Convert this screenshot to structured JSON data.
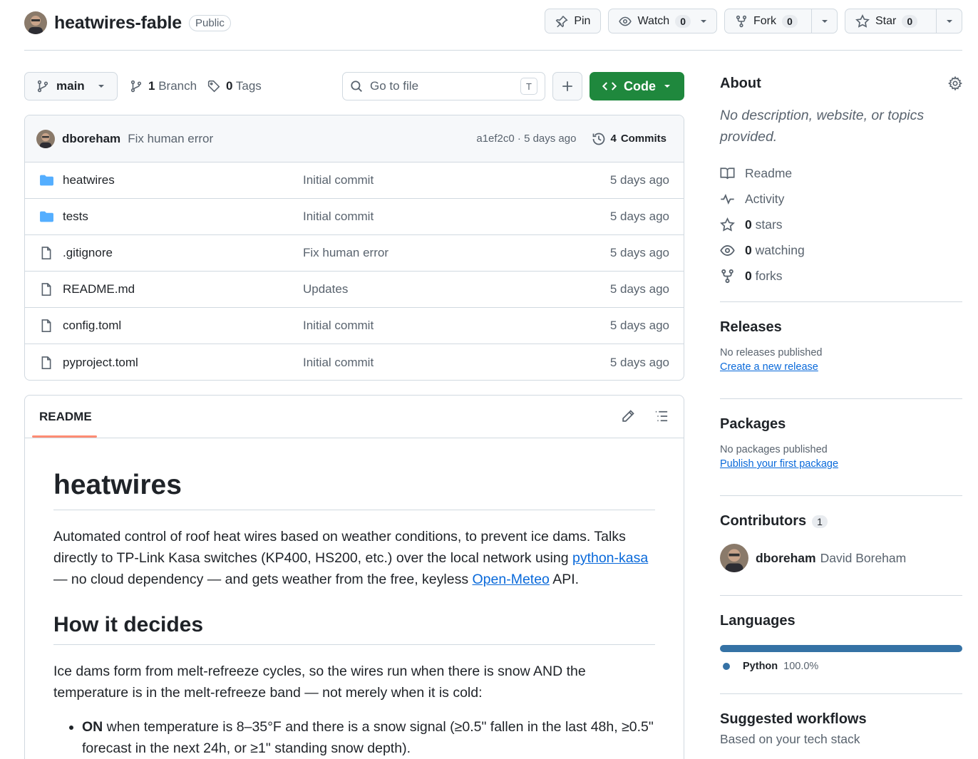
{
  "repo": {
    "name": "heatwires-fable",
    "visibility": "Public"
  },
  "header_actions": {
    "pin": "Pin",
    "watch": "Watch",
    "watch_count": "0",
    "fork": "Fork",
    "fork_count": "0",
    "star": "Star",
    "star_count": "0"
  },
  "toolbar": {
    "branch": "main",
    "branches_count": "1",
    "branches_label": "Branch",
    "tags_count": "0",
    "tags_label": "Tags",
    "search_placeholder": "Go to file",
    "search_shortcut": "T",
    "code_label": "Code"
  },
  "latest_commit": {
    "author": "dboreham",
    "message": "Fix human error",
    "sha_time": "a1ef2c0 · 5 days ago",
    "commits_count": "4",
    "commits_label": "Commits"
  },
  "files": [
    {
      "name": "heatwires",
      "type": "folder",
      "message": "Initial commit",
      "date": "5 days ago"
    },
    {
      "name": "tests",
      "type": "folder",
      "message": "Initial commit",
      "date": "5 days ago"
    },
    {
      "name": ".gitignore",
      "type": "file",
      "message": "Fix human error",
      "date": "5 days ago"
    },
    {
      "name": "README.md",
      "type": "file",
      "message": "Updates",
      "date": "5 days ago"
    },
    {
      "name": "config.toml",
      "type": "file",
      "message": "Initial commit",
      "date": "5 days ago"
    },
    {
      "name": "pyproject.toml",
      "type": "file",
      "message": "Initial commit",
      "date": "5 days ago"
    }
  ],
  "readme": {
    "tab": "README",
    "h1": "heatwires",
    "p1_a": "Automated control of roof heat wires based on weather conditions, to prevent ice dams. Talks directly to TP-Link Kasa switches (KP400, HS200, etc.) over the local network using ",
    "p1_link1": "python-kasa",
    "p1_b": " — no cloud dependency — and gets weather from the free, keyless ",
    "p1_link2": "Open-Meteo",
    "p1_c": " API.",
    "h2": "How it decides",
    "p2": "Ice dams form from melt-refreeze cycles, so the wires run when there is snow AND the temperature is in the melt-refreeze band — not merely when it is cold:",
    "li1_bold": "ON",
    "li1_rest": " when temperature is 8–35°F and there is a snow signal (≥0.5\" fallen in the last 48h, ≥0.5\" forecast in the next 24h, or ≥1\" standing snow depth)."
  },
  "about": {
    "title": "About",
    "description": "No description, website, or topics provided.",
    "readme": "Readme",
    "activity": "Activity",
    "stars_count": "0",
    "stars_label": "stars",
    "watching_count": "0",
    "watching_label": "watching",
    "forks_count": "0",
    "forks_label": "forks"
  },
  "releases": {
    "title": "Releases",
    "empty": "No releases published",
    "link": "Create a new release"
  },
  "packages": {
    "title": "Packages",
    "empty": "No packages published",
    "link": "Publish your first package"
  },
  "contributors": {
    "title": "Contributors",
    "count": "1",
    "login": "dboreham",
    "full_name": "David Boreham"
  },
  "languages": {
    "title": "Languages",
    "name": "Python",
    "percent": "100.0%",
    "color": "#3572A5"
  },
  "workflows": {
    "title": "Suggested workflows",
    "subtitle": "Based on your tech stack"
  },
  "colors": {
    "primary_button": "#1f883d",
    "link": "#0969da",
    "folder_icon": "#54aeff",
    "tab_underline": "#fd8c73"
  }
}
